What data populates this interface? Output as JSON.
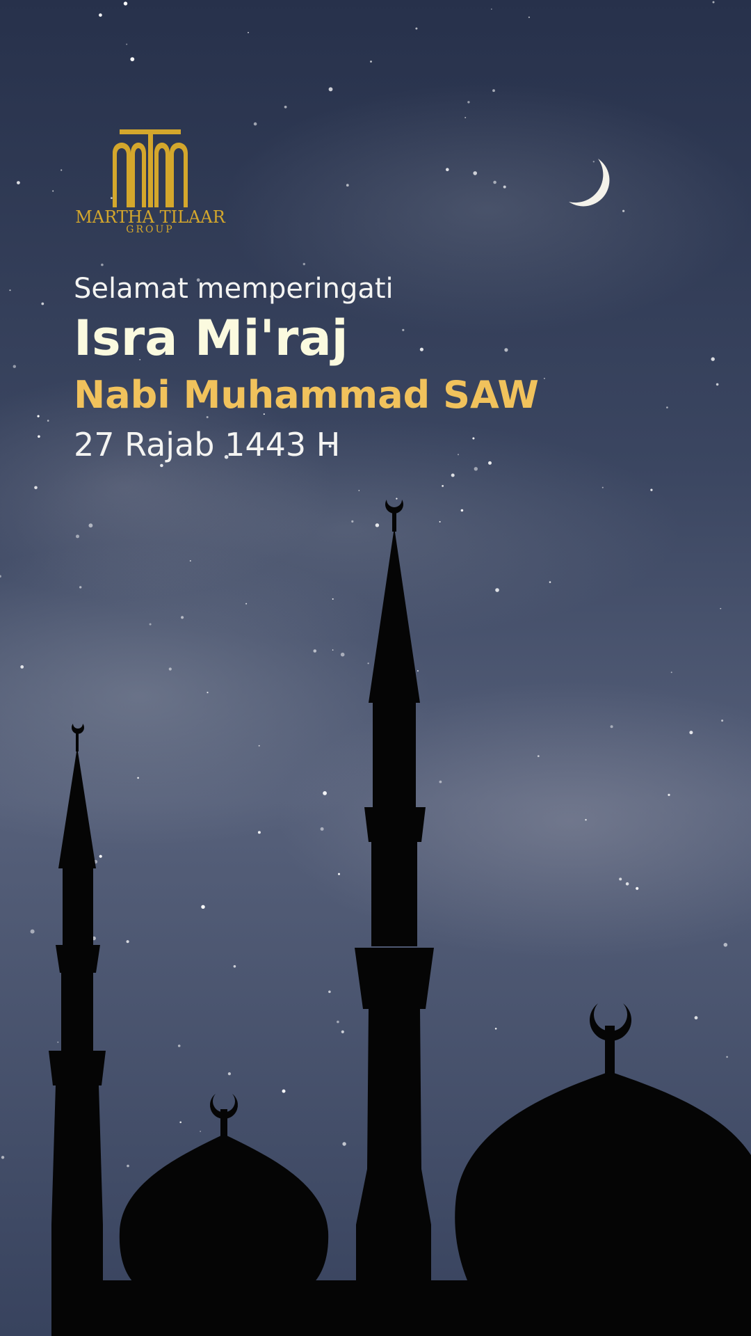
{
  "logo": {
    "name": "MARTHA TILAAR",
    "group": "GROUP",
    "color": "#d4a72c"
  },
  "greeting": "Selamat memperingati",
  "headline": "Isra Mi'raj",
  "subtitle": "Nabi Muhammad SAW",
  "date": "27 Rajab 1443 H",
  "colors": {
    "sky_top": "#26304a",
    "sky_mid": "#4b5670",
    "sky_bottom": "#3a4560",
    "silhouette": "#050505",
    "headline": "#fbfadf",
    "subtitle": "#f1c25c",
    "text": "#f4f4f2"
  }
}
